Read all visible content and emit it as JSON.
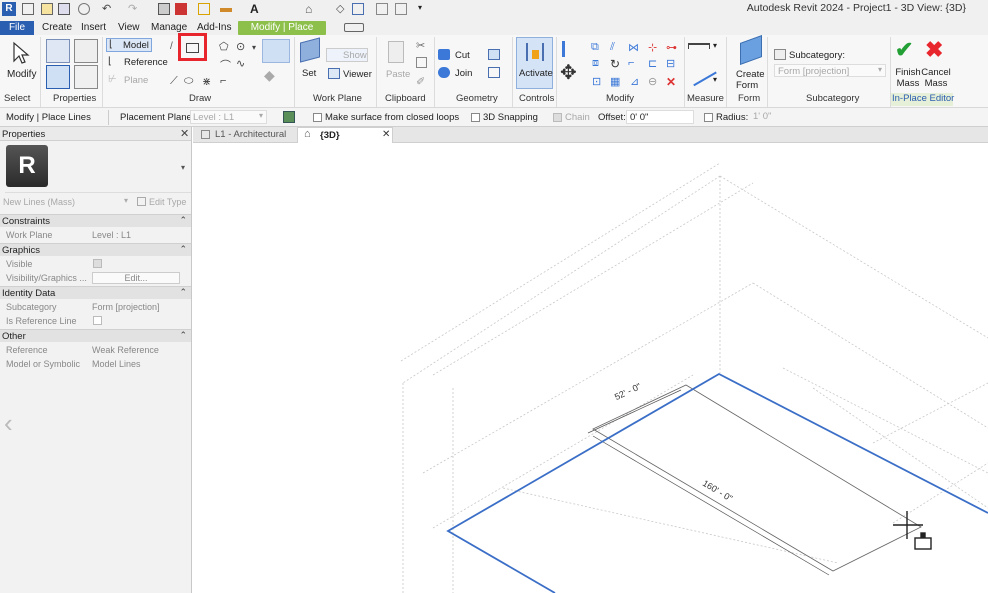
{
  "app_title": "Autodesk Revit 2024 - Project1 - 3D View: {3D}",
  "menu_tabs": [
    "File",
    "Create",
    "Insert",
    "View",
    "Manage",
    "Add-Ins",
    "Modify | Place Lines"
  ],
  "ribbon": {
    "modify_label": "Modify",
    "model_label": "Model",
    "reference_label": "Reference",
    "plane_label": "Plane",
    "set_label": "Set",
    "show_label": "Show",
    "viewer_label": "Viewer",
    "paste_label": "Paste",
    "cut_label": "Cut",
    "join_label": "Join",
    "activate_label": "Activate",
    "create_form_label": "Create Form",
    "subcategory_label": "Subcategory:",
    "subcategory_value": "Form [projection]",
    "finish_mass_label": "Finish Mass",
    "cancel_mass_label": "Cancel Mass",
    "panels": [
      "Select",
      "Properties",
      "Draw",
      "Work Plane",
      "Clipboard",
      "Geometry",
      "Controls",
      "Modify",
      "Measure",
      "Form",
      "Subcategory",
      "In-Place Editor"
    ]
  },
  "options_bar": {
    "context": "Modify | Place Lines",
    "placement_plane_label": "Placement Plane:",
    "placement_plane_value": "Level : L1",
    "make_surface_label": "Make surface from closed loops",
    "snapping_label": "3D Snapping",
    "chain_label": "Chain",
    "offset_label": "Offset:",
    "offset_value": "0'  0\"",
    "radius_label": "Radius:",
    "radius_value": "1'  0\""
  },
  "properties": {
    "title": "Properties",
    "type_name": "New Lines (Mass)",
    "edit_type_label": "Edit Type",
    "sections": {
      "constraints": "Constraints",
      "graphics": "Graphics",
      "identity": "Identity Data",
      "other": "Other"
    },
    "rows": {
      "work_plane": {
        "label": "Work Plane",
        "value": "Level : L1"
      },
      "visible": {
        "label": "Visible"
      },
      "visibility_graphics": {
        "label": "Visibility/Graphics ...",
        "value": "Edit..."
      },
      "subcategory": {
        "label": "Subcategory",
        "value": "Form [projection]"
      },
      "is_reference_line": {
        "label": "Is Reference Line"
      },
      "reference": {
        "label": "Reference",
        "value": "Weak Reference"
      },
      "model_or_symbolic": {
        "label": "Model or Symbolic",
        "value": "Model Lines"
      }
    }
  },
  "view_tabs": [
    "L1 - Architectural",
    "{3D}"
  ],
  "dimensions": {
    "short": "52' - 0\"",
    "long": "160' - 0\""
  },
  "colors": {
    "accent_blue": "#2a5eb0",
    "context_green": "#8cc04a",
    "highlight_red": "#e8242c",
    "sketch_line": "#3b6fc7"
  }
}
